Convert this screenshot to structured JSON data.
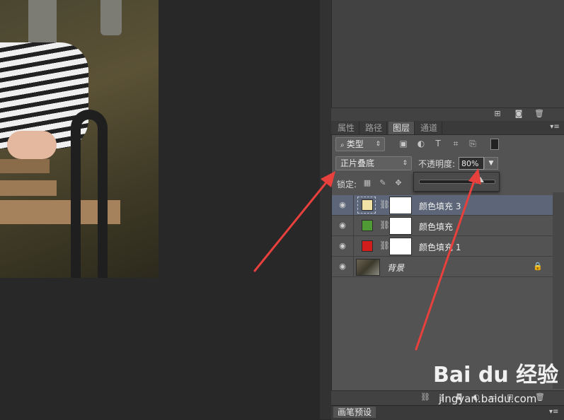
{
  "layers_panel": {
    "tabs": [
      "属性",
      "路径",
      "图层",
      "通道"
    ],
    "active_tab": "图层",
    "filter": {
      "label": "类型"
    },
    "blend_mode": {
      "value": "正片叠底"
    },
    "opacity": {
      "label": "不透明度:",
      "value": "80%"
    },
    "lock": {
      "label": "锁定:"
    },
    "layers": [
      {
        "name": "颜色填充 3",
        "swatch": "#f3e2a6",
        "selected": true
      },
      {
        "name": "颜色填充",
        "swatch": "#4f9a34",
        "selected": false
      },
      {
        "name": "颜色填充 1",
        "swatch": "#d21d1d",
        "selected": false
      },
      {
        "name": "背景",
        "is_background": true,
        "locked": true
      }
    ]
  },
  "brush_panel": {
    "tab": "画笔预设"
  },
  "watermark": {
    "brand": "Bai du 经验",
    "url": "jingyan.baidu.com"
  },
  "colors": {
    "annotation_arrow": "#e8403c",
    "selected_row": "#5c6678",
    "panel": "#535353"
  }
}
